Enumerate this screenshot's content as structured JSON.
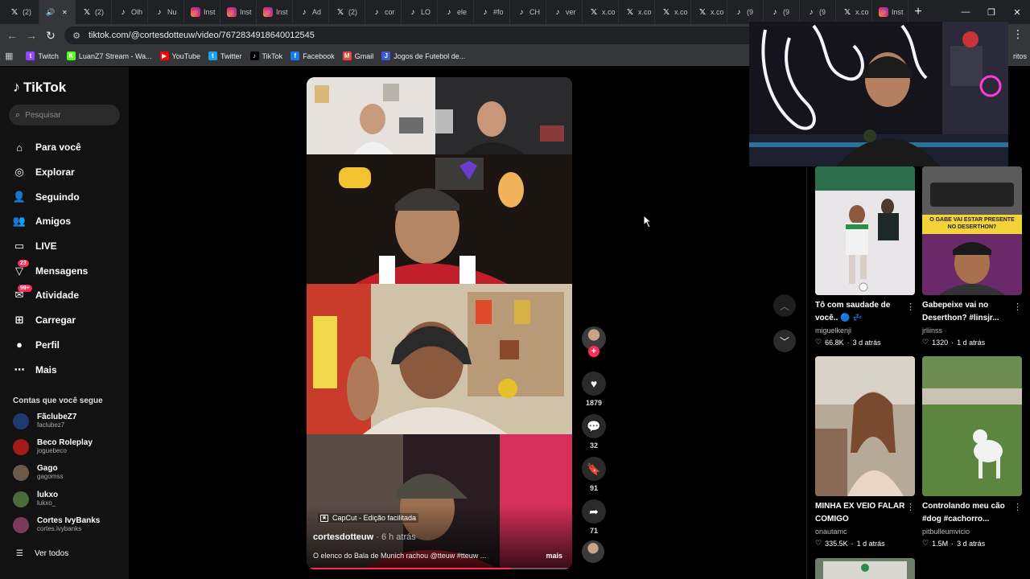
{
  "browser": {
    "tabs": [
      {
        "icon": "x",
        "label": "(2)"
      },
      {
        "icon": "sp",
        "label": "",
        "active": true
      },
      {
        "icon": "x",
        "label": "(2)"
      },
      {
        "icon": "tt",
        "label": "Olh"
      },
      {
        "icon": "tt",
        "label": "Nu"
      },
      {
        "icon": "ig",
        "label": "Inst"
      },
      {
        "icon": "ig",
        "label": "Inst"
      },
      {
        "icon": "ig",
        "label": "Inst"
      },
      {
        "icon": "tt",
        "label": "Ad"
      },
      {
        "icon": "x",
        "label": "(2)"
      },
      {
        "icon": "tt",
        "label": "cor"
      },
      {
        "icon": "tt",
        "label": "LO"
      },
      {
        "icon": "tt",
        "label": "ele"
      },
      {
        "icon": "tt",
        "label": "#fo"
      },
      {
        "icon": "tt",
        "label": "CH"
      },
      {
        "icon": "tt",
        "label": "ver"
      },
      {
        "icon": "x",
        "label": "x.co"
      },
      {
        "icon": "x",
        "label": "x.co"
      },
      {
        "icon": "x",
        "label": "x.co"
      },
      {
        "icon": "x",
        "label": "x.co"
      },
      {
        "icon": "tt",
        "label": "(9"
      },
      {
        "icon": "tt",
        "label": "(9"
      },
      {
        "icon": "tt",
        "label": "(9"
      },
      {
        "icon": "x",
        "label": "x.co"
      },
      {
        "icon": "ig",
        "label": "Inst"
      }
    ],
    "new_tab": "+",
    "url": "tiktok.com/@cortesdotteuw/video/7672834918640012545",
    "bookmarks": [
      {
        "label": "Twitch",
        "color": "#9146ff",
        "glyph": "t"
      },
      {
        "label": "LuanZ7 Stream - Wa...",
        "color": "#53fc18",
        "glyph": "K"
      },
      {
        "label": "YouTube",
        "color": "#ff0000",
        "glyph": "▶"
      },
      {
        "label": "Twitter",
        "color": "#1da1f2",
        "glyph": "t"
      },
      {
        "label": "TikTok",
        "color": "#000000",
        "glyph": "♪"
      },
      {
        "label": "Facebook",
        "color": "#1877f2",
        "glyph": "f"
      },
      {
        "label": "Gmail",
        "color": "#ea4335",
        "glyph": "M"
      },
      {
        "label": "Jogos de Futebol de...",
        "color": "#3b5bdb",
        "glyph": "J"
      }
    ],
    "bookmarks_right": "ritos"
  },
  "tiktok": {
    "logo": "TikTok",
    "search_placeholder": "Pesquisar",
    "nav": [
      {
        "label": "Para você",
        "icon": "home-icon",
        "glyph": "⌂"
      },
      {
        "label": "Explorar",
        "icon": "compass-icon",
        "glyph": "◎"
      },
      {
        "label": "Seguindo",
        "icon": "person-follow-icon",
        "glyph": "👤"
      },
      {
        "label": "Amigos",
        "icon": "friends-icon",
        "glyph": "👥"
      },
      {
        "label": "LIVE",
        "icon": "live-icon",
        "glyph": "▭"
      },
      {
        "label": "Mensagens",
        "icon": "messages-icon",
        "glyph": "▽",
        "badge": "23"
      },
      {
        "label": "Atividade",
        "icon": "activity-icon",
        "glyph": "✉",
        "badge": "99+"
      },
      {
        "label": "Carregar",
        "icon": "upload-icon",
        "glyph": "⊞"
      },
      {
        "label": "Perfil",
        "icon": "profile-icon",
        "glyph": "●"
      },
      {
        "label": "Mais",
        "icon": "more-icon",
        "glyph": "⋯"
      }
    ],
    "following_title": "Contas que você segue",
    "following": [
      {
        "name": "FãclubeZ7",
        "handle": "faclubez7",
        "color": "#1f3a6e"
      },
      {
        "name": "Beco Roleplay",
        "handle": "joguebeco",
        "color": "#a31c1c"
      },
      {
        "name": "Gago",
        "handle": "gagomss",
        "color": "#6b5a4a"
      },
      {
        "name": "lukxo",
        "handle": "lukxo_",
        "color": "#4d6b3a"
      },
      {
        "name": "Cortes IvyBanks",
        "handle": "cortes.ivybanks",
        "color": "#7a3b5a"
      }
    ],
    "see_all": "Ver todos",
    "video": {
      "capcut": "CapCut - Edição facilitada",
      "author": "cortesdotteuw",
      "time": " · 6 h atrás",
      "caption": "O elenco do Bala de Munich rachou @tteuw #tteuw ...",
      "more": "mais",
      "progress": 0.77
    },
    "actions": {
      "likes": "1879",
      "comments": "32",
      "saves": "91",
      "shares": "71"
    },
    "recommended": [
      {
        "title": "Tô com saudade de você.. 🔵 💤",
        "author": "miguelkenji",
        "likes": "66.8K",
        "age": "3 d atrás"
      },
      {
        "title": "Gabepeixe vai no Deserthon? #linsjr...",
        "author": "jrliinss",
        "likes": "1320",
        "age": "1 d atrás",
        "thumb_text": "O GABE VAI ESTAR PRESENTE NO DESERTHON?"
      },
      {
        "title": "MINHA EX VEIO FALAR COMIGO",
        "author": "onautamc",
        "likes": "335.5K",
        "age": "1 d atrás"
      },
      {
        "title": "Controlando meu cão #dog #cachorro...",
        "author": "pitbulleumvicio",
        "likes": "1.5M",
        "age": "3 d atrás"
      }
    ]
  }
}
